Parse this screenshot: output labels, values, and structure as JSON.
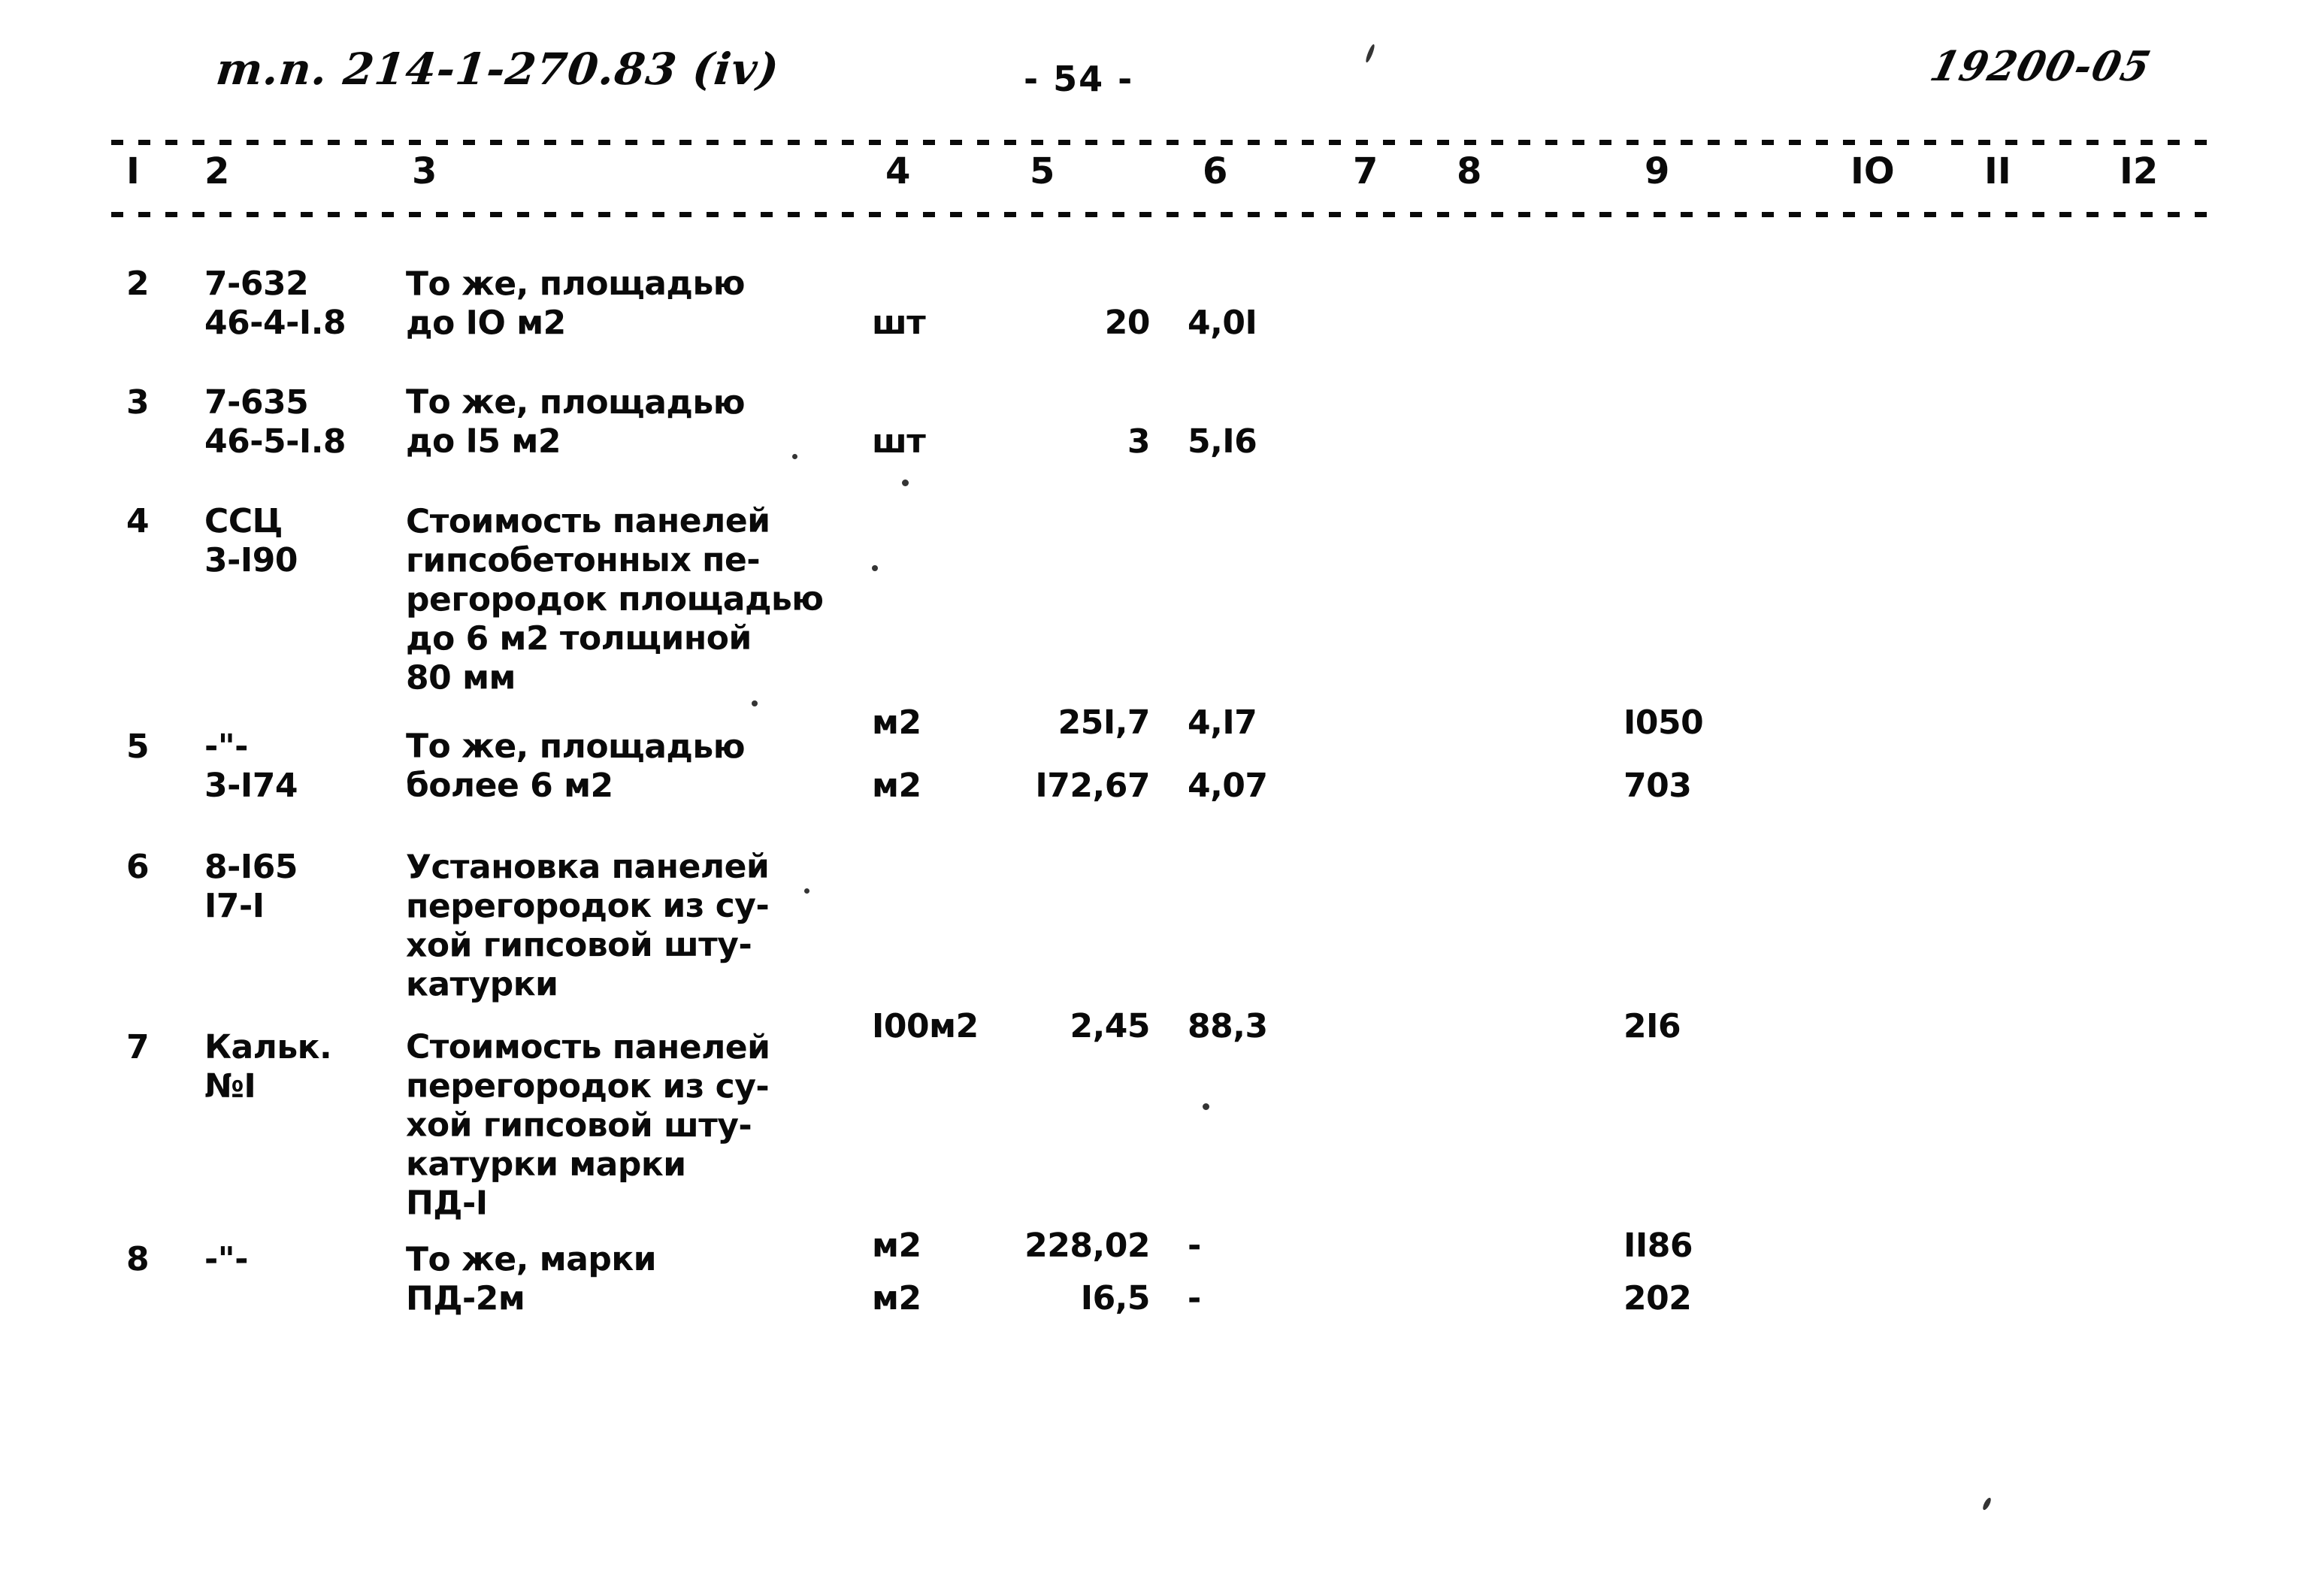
{
  "header": {
    "handwritten_project_code": "т.п. 214-1-270.83 (iv)",
    "page_number": "- 54 -",
    "handwritten_archive_code": "19200-05"
  },
  "table": {
    "column_headers": [
      "I",
      "2",
      "3",
      "4",
      "5",
      "6",
      "7",
      "8",
      "9",
      "IO",
      "II",
      "I2"
    ],
    "rows": [
      {
        "num": "2",
        "code_lines": [
          "7-632",
          "46-4-I.8"
        ],
        "desc_lines": [
          "То же, площадью",
          "до IO м2"
        ],
        "unit": "шт",
        "qty": "20",
        "price": "4,0I",
        "col7": "",
        "col8": "",
        "total": ""
      },
      {
        "num": "3",
        "code_lines": [
          "7-635",
          "46-5-I.8"
        ],
        "desc_lines": [
          "То же, площадью",
          "до I5 м2"
        ],
        "unit": "шт",
        "qty": "3",
        "price": "5,I6",
        "col7": "",
        "col8": "",
        "total": ""
      },
      {
        "num": "4",
        "code_lines": [
          "ССЦ",
          "3-I90"
        ],
        "desc_lines": [
          "Стоимость панелей",
          "гипсобетонных пе-",
          "регородок площадью",
          "до 6 м2 толщиной",
          "80 мм"
        ],
        "unit": "м2",
        "qty": "25I,7",
        "price": "4,I7",
        "col7": "",
        "col8": "",
        "total": "I050"
      },
      {
        "num": "5",
        "code_lines": [
          "-\"-",
          "3-I74"
        ],
        "desc_lines": [
          "То же, площадью",
          "более 6 м2"
        ],
        "unit": "м2",
        "qty": "I72,67",
        "price": "4,07",
        "col7": "",
        "col8": "",
        "total": "703"
      },
      {
        "num": "6",
        "code_lines": [
          "8-I65",
          "I7-I"
        ],
        "desc_lines": [
          "Установка панелей",
          "перегородок из су-",
          "хой гипсовой шту-",
          "катурки"
        ],
        "unit": "I00м2",
        "qty": "2,45",
        "price": "88,3",
        "col7": "",
        "col8": "",
        "total": "2I6"
      },
      {
        "num": "7",
        "code_lines": [
          "Кальк.",
          "№I"
        ],
        "desc_lines": [
          "Стоимость панелей",
          "перегородок из су-",
          "хой гипсовой шту-",
          "катурки марки",
          "ПД-I"
        ],
        "unit": "м2",
        "qty": "228,02",
        "price": "-",
        "col7": "",
        "col8": "",
        "total": "II86"
      },
      {
        "num": "8",
        "code_lines": [
          "-\"-",
          ""
        ],
        "desc_lines": [
          "То же, марки",
          "ПД-2м"
        ],
        "unit": "м2",
        "qty": "I6,5",
        "price": "-",
        "col7": "",
        "col8": "",
        "total": "202"
      }
    ]
  }
}
